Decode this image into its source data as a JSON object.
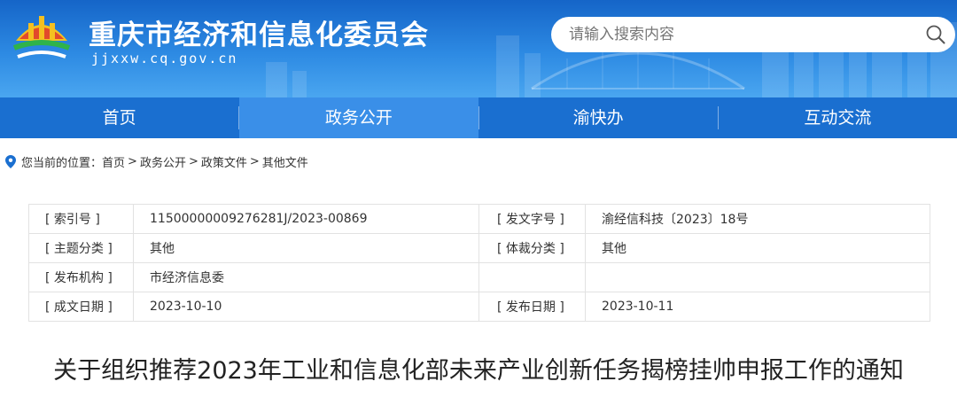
{
  "header": {
    "title": "重庆市经济和信息化委员会",
    "domain": "jjxxw.cq.gov.cn",
    "colors": {
      "banner_top": "#1565c8",
      "banner_bottom": "#4aa6f0",
      "nav": "#1a6fd0",
      "nav_active": "#3a8fe8"
    },
    "logo_icon": "city-emblem-icon"
  },
  "search": {
    "placeholder": "请输入搜索内容",
    "value": "",
    "icon": "search-icon"
  },
  "nav": {
    "items": [
      {
        "label": "首页",
        "active": false
      },
      {
        "label": "政务公开",
        "active": true
      },
      {
        "label": "渝快办",
        "active": false
      },
      {
        "label": "互动交流",
        "active": false
      }
    ]
  },
  "breadcrumb": {
    "icon": "location-pin-icon",
    "prefix": "您当前的位置：",
    "items": [
      "首页",
      "政务公开",
      "政策文件",
      "其他文件"
    ],
    "separator": ">"
  },
  "meta": {
    "rows": [
      {
        "label1": "[ 索引号 ]",
        "value1": "11500000009276281J/2023-00869",
        "label2": "[ 发文字号 ]",
        "value2": "渝经信科技〔2023〕18号"
      },
      {
        "label1": "[ 主题分类 ]",
        "value1": "其他",
        "label2": "[ 体裁分类 ]",
        "value2": "其他"
      },
      {
        "label1": "[ 发布机构 ]",
        "value1": "市经济信息委",
        "label2": "",
        "value2": ""
      },
      {
        "label1": "[ 成文日期 ]",
        "value1": "2023-10-10",
        "label2": "[ 发布日期 ]",
        "value2": "2023-10-11"
      }
    ]
  },
  "article": {
    "title": "关于组织推荐2023年工业和信息化部未来产业创新任务揭榜挂帅申报工作的通知"
  }
}
